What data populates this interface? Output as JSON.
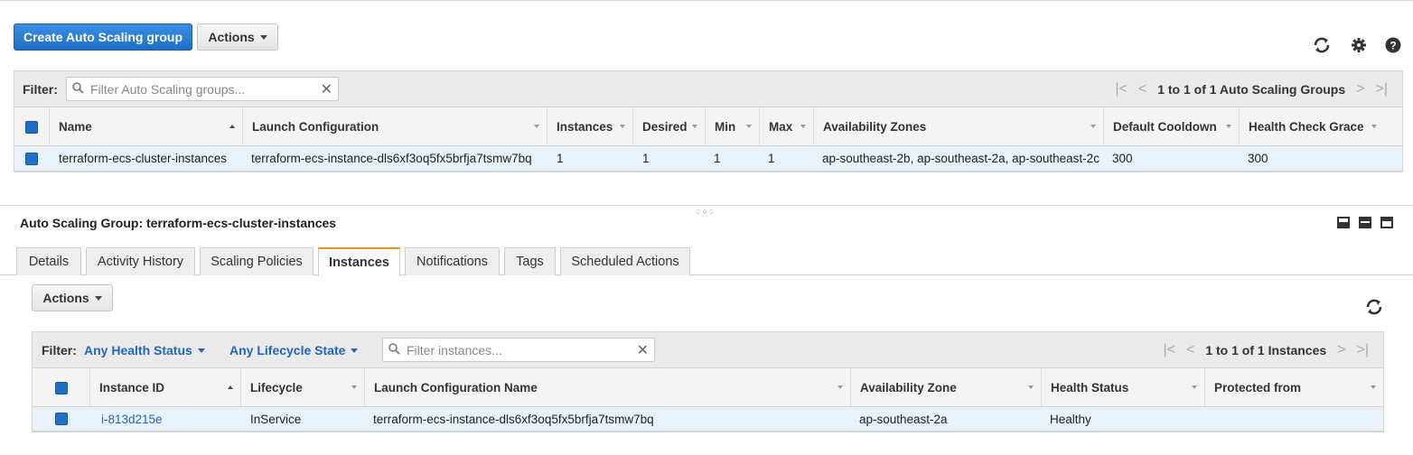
{
  "toolbar": {
    "create_label": "Create Auto Scaling group",
    "actions_label": "Actions"
  },
  "icons": [
    "refresh-icon",
    "gear-icon",
    "help-icon"
  ],
  "groups": {
    "filter_label": "Filter:",
    "search_placeholder": "Filter Auto Scaling groups...",
    "pager_text": "1 to 1 of 1 Auto Scaling Groups",
    "columns": [
      "Name",
      "Launch Configuration",
      "Instances",
      "Desired",
      "Min",
      "Max",
      "Availability Zones",
      "Default Cooldown",
      "Health Check Grace"
    ],
    "rows": [
      {
        "name": "terraform-ecs-cluster-instances",
        "launch_configuration": "terraform-ecs-instance-dls6xf3oq5fx5brfja7tsmw7bq",
        "instances": "1",
        "desired": "1",
        "min": "1",
        "max": "1",
        "availability_zones": "ap-southeast-2b, ap-southeast-2a, ap-southeast-2c",
        "default_cooldown": "300",
        "health_check_grace": "300"
      }
    ]
  },
  "detail": {
    "title": "Auto Scaling Group: terraform-ecs-cluster-instances",
    "tabs": [
      "Details",
      "Activity History",
      "Scaling Policies",
      "Instances",
      "Notifications",
      "Tags",
      "Scheduled Actions"
    ],
    "active_tab": "Instances",
    "actions_label": "Actions",
    "filter_label": "Filter:",
    "health_filter": "Any Health Status",
    "lifecycle_filter": "Any Lifecycle State",
    "search_placeholder": "Filter instances...",
    "pager_text": "1 to 1 of 1 Instances",
    "columns": [
      "Instance ID",
      "Lifecycle",
      "Launch Configuration Name",
      "Availability Zone",
      "Health Status",
      "Protected from"
    ],
    "rows": [
      {
        "instance_id": "i-813d215e",
        "lifecycle": "InService",
        "launch_configuration_name": "terraform-ecs-instance-dls6xf3oq5fx5brfja7tsmw7bq",
        "availability_zone": "ap-southeast-2a",
        "health_status": "Healthy",
        "protected_from": ""
      }
    ]
  },
  "colors": {
    "primary": "#1e6fc6",
    "link": "#1d66c1",
    "active_tab_accent": "#e8902b",
    "selected_row": "#e9f1fb"
  }
}
